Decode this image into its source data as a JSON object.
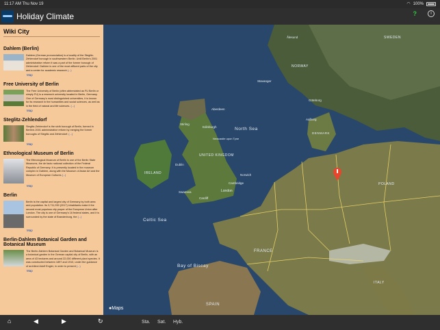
{
  "status": {
    "time_date": "11:17 AM   Thu Nov 19",
    "battery": "100%"
  },
  "app": {
    "title": "Holiday Climate"
  },
  "sidebar": {
    "title": "Wiki City",
    "entries": [
      {
        "title": "Dahlem (Berlin)",
        "text": "Dahlem (German pronunciation) is a locality of the Steglitz-Zehlendorf borough in southwestern Berlin. Until Berlin's 2001 administrative reform it was a part of the former borough of Zehlendorf. Dahlem is one of the most affluent parts of the city and a center for academic research",
        "more": "(...)",
        "link": "Map"
      },
      {
        "title": "Free University of Berlin",
        "text": "The Free University of Berlin (often abbreviated as FU Berlin or simply FU) is a research university located in Berlin, Germany. One of Germany's most distinguished universities, it is known for its research in the humanities and social sciences, as well as in the field of natural and life sciences.",
        "more": "(...)",
        "link": "Map"
      },
      {
        "title": "Steglitz-Zehlendorf",
        "text": "Steglitz-Zehlendorf is the sixth borough of Berlin, formed in Berlin's 2001 administrative reform by merging the former boroughs of Steglitz and Zehlendorf.",
        "more": "(...)",
        "link": "Map"
      },
      {
        "title": "Ethnological Museum of Berlin",
        "text": "The Ethnological Museum of Berlin is one of the Berlin State Museums, the de facto national collection of the Federal Republic of Germany. It is presently located in the museum complex in Dahlem, along with the Museum of Asian Art and the Museum of European Cultures",
        "more": "(...)",
        "link": "Map"
      },
      {
        "title": "Berlin",
        "text": "Berlin is the capital and largest city of Germany by both area and population. Its 3,711,930 (2017) inhabitants make it the second most populous city proper of the European Union after London. The city is one of Germany's 16 federal states, and it is surrounded by the state of Brandenburg, the",
        "more": "(...)",
        "link": "Map"
      },
      {
        "title": "Berlin-Dahlem Botanical Garden and Botanical Museum",
        "text": "The Berlin-Dahlem Botanical Garden and Botanical Museum is a botanical garden in the German capital city of Berlin, with an area of 43 hectares and around 22,000 different plant species. It was constructed between 1897 and 1910, under the guidance of architect Adolf Engler, in order to present",
        "more": "(...)",
        "link": "Map"
      }
    ]
  },
  "map": {
    "attribution": "Maps",
    "sea_labels": [
      "North Sea",
      "Celtic Sea",
      "Bay of Biscay"
    ],
    "city_labels": [
      "Aberdeen",
      "Edinburgh",
      "Newcastle upon Tyne",
      "Dublin",
      "Cardiff",
      "London",
      "Cambridge",
      "Swansea",
      "Norwich",
      "Stirling",
      "Stavanger",
      "Göteborg",
      "Aalborg",
      "Ålesund"
    ],
    "country_labels": [
      "NORWAY",
      "SWEDEN",
      "DENMARK",
      "UNITED KINGDOM",
      "IRELAND",
      "FRANCE",
      "POLAND",
      "SPAIN",
      "ITALY"
    ]
  },
  "toolbar": {
    "sta": "Sta.",
    "sat": "Sat.",
    "hyb": "Hyb."
  },
  "colors": {
    "sidebar": "#f6c99b",
    "bar": "#2f2f2f",
    "pin": "#e8452c"
  }
}
